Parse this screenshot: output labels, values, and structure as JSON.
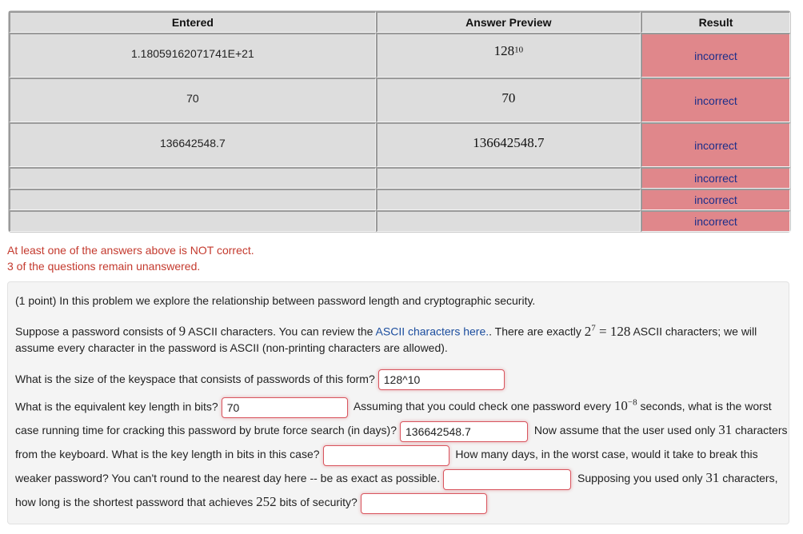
{
  "results_table": {
    "headers": [
      "Entered",
      "Answer Preview",
      "Result"
    ],
    "rows": [
      {
        "entered": "1.18059162071741E+21",
        "preview_base": "128",
        "preview_exp": "10",
        "result": "incorrect"
      },
      {
        "entered": "70",
        "preview_base": "70",
        "preview_exp": "",
        "result": "incorrect"
      },
      {
        "entered": "136642548.7",
        "preview_base": "136642548.7",
        "preview_exp": "",
        "result": "incorrect"
      },
      {
        "entered": "",
        "preview_base": "",
        "preview_exp": "",
        "result": "incorrect"
      },
      {
        "entered": "",
        "preview_base": "",
        "preview_exp": "",
        "result": "incorrect"
      },
      {
        "entered": "",
        "preview_base": "",
        "preview_exp": "",
        "result": "incorrect"
      }
    ]
  },
  "messages": {
    "not_correct": "At least one of the answers above is NOT correct.",
    "unanswered": "3 of the questions remain unanswered."
  },
  "colors": {
    "incorrect_bg": "#e0878b",
    "message_red": "#c43a2e",
    "link_blue": "#1b4d9e"
  },
  "problem": {
    "intro": "(1 point) In this problem we explore the relationship between password length and cryptographic security.",
    "suppose_a": "Suppose a password consists of ",
    "num_chars": "9",
    "suppose_b": " ASCII characters. You can review the ",
    "link_text": "ASCII characters here.",
    "suppose_c": ". There are exactly ",
    "pow_base": "2",
    "pow_exp": "7",
    "eq": " = 128",
    "suppose_d": " ASCII characters; we will assume every character in the password is ASCII (non-printing characters are allowed).",
    "q1": "What is the size of the keyspace that consists of passwords of this form?",
    "a1": "128^10",
    "q2": "What is the equivalent key length in bits?",
    "a2": "70",
    "q3a": "Assuming that you could check one password every ",
    "q3_base": "10",
    "q3_exp": "−8",
    "q3b": " seconds, what is the worst case running time for cracking this password by brute force search (in days)?",
    "a3": "136642548.7",
    "q4a": "Now assume that the user used only ",
    "q4_num": "31",
    "q4b": " characters from the keyboard. What is the key length in bits in this case?",
    "a4": "",
    "q5": "How many days, in the worst case, would it take to break this weaker password? You can't round to the nearest day here -- be as exact as possible.",
    "a5": "",
    "q6a": "Supposing you used only ",
    "q6_num": "31",
    "q6b": " characters, how long is the shortest password that achieves ",
    "q6_bits": "252",
    "q6c": " bits of security?",
    "a6": ""
  }
}
